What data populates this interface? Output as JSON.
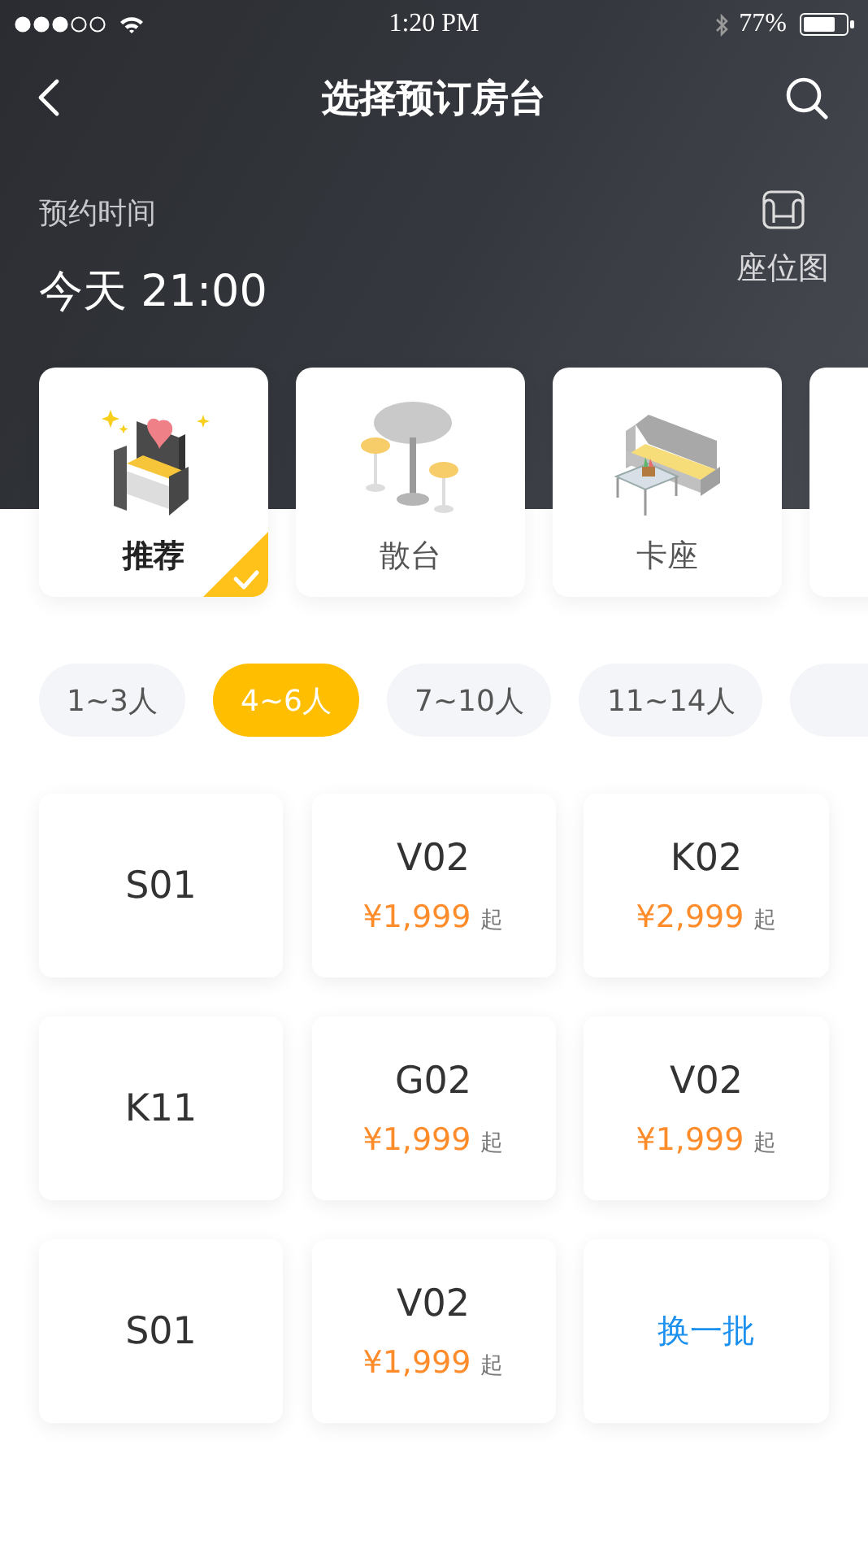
{
  "status_bar": {
    "time": "1:20 PM",
    "battery_text": "77%"
  },
  "nav": {
    "title": "选择预订房台"
  },
  "booking": {
    "label": "预约时间",
    "time": "今天 21:00",
    "seat_map": "座位图"
  },
  "categories": [
    {
      "label": "推荐",
      "kind": "recommend",
      "selected": true
    },
    {
      "label": "散台",
      "kind": "table",
      "selected": false
    },
    {
      "label": "卡座",
      "kind": "sofa",
      "selected": false
    }
  ],
  "party_sizes": [
    {
      "label": "1~3人",
      "selected": false
    },
    {
      "label": "4~6人",
      "selected": true
    },
    {
      "label": "7~10人",
      "selected": false
    },
    {
      "label": "11~14人",
      "selected": false
    }
  ],
  "rooms": [
    {
      "kind": "room",
      "name": "S01"
    },
    {
      "kind": "room",
      "name": "V02",
      "price": "¥1,999",
      "suffix": "起"
    },
    {
      "kind": "room",
      "name": "K02",
      "price": "¥2,999",
      "suffix": "起"
    },
    {
      "kind": "room",
      "name": "K11"
    },
    {
      "kind": "room",
      "name": "G02",
      "price": "¥1,999",
      "suffix": "起"
    },
    {
      "kind": "room",
      "name": "V02",
      "price": "¥1,999",
      "suffix": "起"
    },
    {
      "kind": "room",
      "name": "S01"
    },
    {
      "kind": "room",
      "name": "V02",
      "price": "¥1,999",
      "suffix": "起"
    },
    {
      "kind": "action",
      "label": "换一批"
    }
  ]
}
